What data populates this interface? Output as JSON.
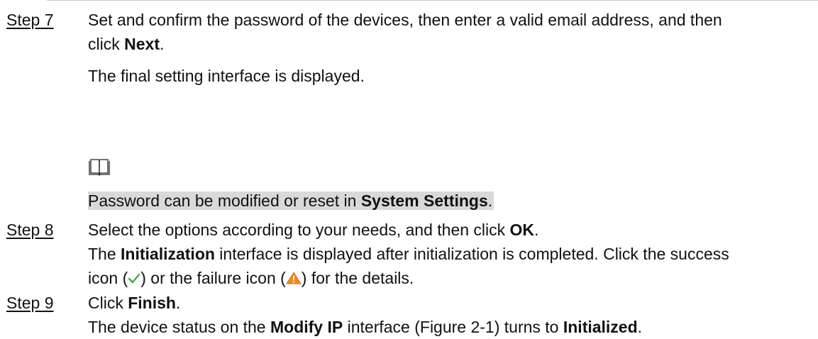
{
  "step7": {
    "label": "Step 7",
    "line1": "Set and confirm the password of the devices, then enter a valid email address, and then",
    "line2_pre": "click ",
    "line2_bold": "Next",
    "line2_post": ".",
    "result": "The final setting interface is displayed."
  },
  "note": {
    "icon": "book-icon",
    "pre": "Password can be modified or reset in ",
    "bold": "System Settings",
    "post": "."
  },
  "step8": {
    "label": "Step 8",
    "line1_pre": "Select the options according to your needs, and then click ",
    "line1_bold": "OK",
    "line1_post": ".",
    "line2_pre": "The ",
    "line2_bold": "Initialization",
    "line2_post": " interface is displayed after initialization is completed. Click the success",
    "line3_a": "icon (",
    "line3_b": ") or the failure icon (",
    "line3_c": ") for the details.",
    "success_icon": "check-icon",
    "failure_icon": "warning-icon",
    "success_color": "#3cb043",
    "failure_color": "#f08a1c"
  },
  "step9": {
    "label": "Step 9",
    "line1_pre": "Click ",
    "line1_bold": "Finish",
    "line1_post": ".",
    "line2_pre": "The device status on the ",
    "line2_bold1": "Modify IP",
    "line2_mid": " interface (Figure 2-1) turns to ",
    "line2_bold2": "Initialized",
    "line2_post": "."
  }
}
